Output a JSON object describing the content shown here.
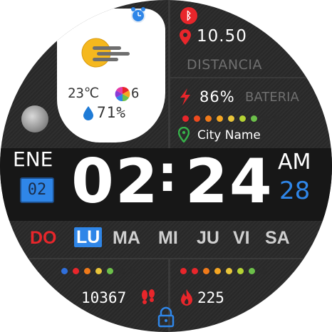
{
  "colors": {
    "accent_red": "#e8262b",
    "accent_blue": "#2f86e8",
    "bg": "#2a2a2a",
    "text": "#ffffff",
    "muted": "#6f6f6f"
  },
  "icons": {
    "alarm": "alarm-clock-icon",
    "bluetooth": "bluetooth-icon",
    "location": "map-pin-icon",
    "battery": "lightning-icon",
    "city_pin": "green-pin-icon",
    "weather": "sun-cloud-icon",
    "humidity": "water-drop-icon",
    "uv": "color-wheel-icon",
    "moon": "moon-icon",
    "steps": "footprints-icon",
    "calories": "flame-icon",
    "lock": "lock-icon"
  },
  "weather": {
    "temperature": "23℃",
    "uv_index": "6",
    "humidity": "71%"
  },
  "distance": {
    "value": "10.50",
    "label": "DISTANCIA"
  },
  "battery": {
    "percent": "86%",
    "label": "BATERIA",
    "dots": [
      "#e8262b",
      "#ee4a1f",
      "#f07a1a",
      "#f5a623",
      "#e9c53a",
      "#b5d334",
      "#6cc04a",
      "#2b2b2b",
      "#2b2b2b"
    ]
  },
  "city": {
    "name": "City Name"
  },
  "date": {
    "month": "ENE",
    "day": "02",
    "weekday_num": "28",
    "ampm": "AM"
  },
  "time": {
    "hours": "02",
    "separator": ":",
    "minutes": "24"
  },
  "weekdays": [
    {
      "label": "DO",
      "state": "sunday"
    },
    {
      "label": "LU",
      "state": "active"
    },
    {
      "label": "MA",
      "state": "normal"
    },
    {
      "label": "MI",
      "state": "normal"
    },
    {
      "label": "JU",
      "state": "normal"
    },
    {
      "label": "VI",
      "state": "normal"
    },
    {
      "label": "SA",
      "state": "normal"
    }
  ],
  "steps": {
    "value": "10367",
    "dots": [
      "#2f6fdc",
      "#e8262b",
      "#f07a1a",
      "#e9c53a",
      "#6cc04a",
      "#2b2b2b",
      "#2b2b2b"
    ]
  },
  "calories": {
    "value": "225",
    "dots": [
      "#e8262b",
      "#e8262b",
      "#f07a1a",
      "#f5a623",
      "#e9c53a",
      "#b5d334",
      "#6cc04a",
      "#2b2b2b"
    ]
  }
}
